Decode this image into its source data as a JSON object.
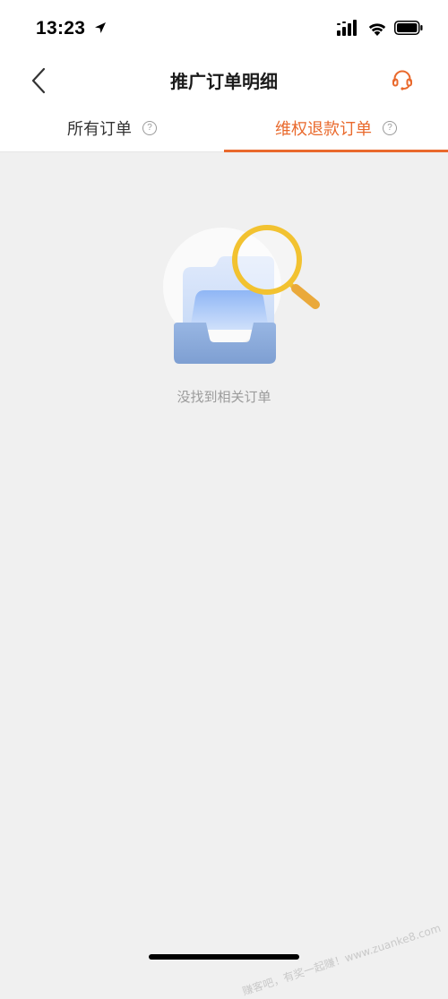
{
  "status_bar": {
    "time": "13:23",
    "icons": [
      "location-arrow-icon",
      "cellular-signal-icon",
      "wifi-icon",
      "battery-icon"
    ]
  },
  "nav": {
    "title": "推广订单明细",
    "back_icon": "chevron-left-icon",
    "service_icon": "customer-service-headset-icon"
  },
  "tabs": [
    {
      "label": "所有订单",
      "help": "?",
      "active": false
    },
    {
      "label": "维权退款订单",
      "help": "?",
      "active": true
    }
  ],
  "empty_state": {
    "icon": "empty-tray-magnifier-icon",
    "message": "没找到相关订单"
  },
  "watermark": "赚客吧，有奖一起赚！www.zuanke8.com",
  "colors": {
    "accent": "#e9692c",
    "background": "#f0f0f0",
    "surface": "#ffffff",
    "magnifier": "#f2c230"
  }
}
